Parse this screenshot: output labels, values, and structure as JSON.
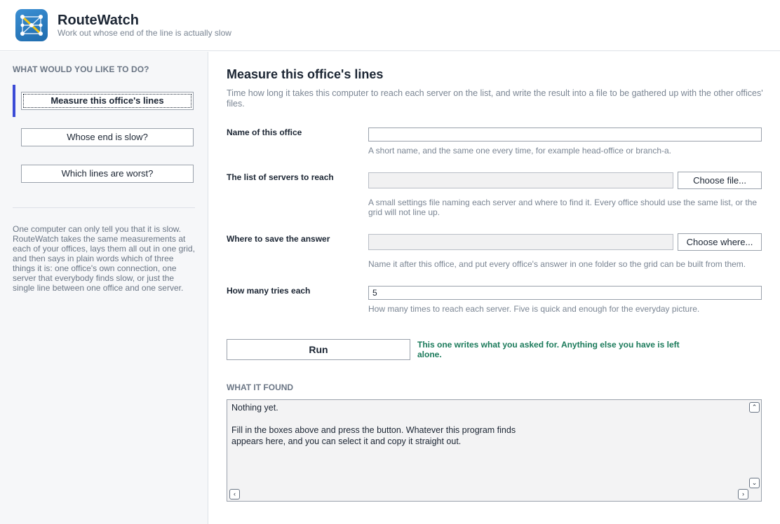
{
  "app": {
    "title": "RouteWatch",
    "subtitle": "Work out whose end of the line is actually slow"
  },
  "sidebar": {
    "heading": "WHAT WOULD YOU LIKE TO DO?",
    "items": [
      {
        "label": "Measure this office's lines",
        "active": true
      },
      {
        "label": "Whose end is slow?",
        "active": false
      },
      {
        "label": "Which lines are worst?",
        "active": false
      }
    ],
    "blurb": "One computer can only tell you that it is slow. RouteWatch takes the same measurements at each of your offices, lays them all out in one grid, and then says in plain words which of three things it is: one office's own connection, one server that everybody finds slow, or just the single line between one office and one server."
  },
  "main": {
    "title": "Measure this office's lines",
    "description": "Time how long it takes this computer to reach each server on the list, and write the result into a file to be gathered up with the other offices' files.",
    "fields": {
      "office_name": {
        "label": "Name of this office",
        "value": "",
        "hint": "A short name, and the same one every time, for example head-office or branch-a."
      },
      "server_list": {
        "label": "The list of servers to reach",
        "value": "",
        "button": "Choose file...",
        "hint": "A small settings file naming each server and where to find it. Every office should use the same list, or the grid will not line up."
      },
      "save_location": {
        "label": "Where to save the answer",
        "value": "",
        "button": "Choose where...",
        "hint": "Name it after this office, and put every office's answer in one folder so the grid can be built from them."
      },
      "tries": {
        "label": "How many tries each",
        "value": "5",
        "hint": "How many times to reach each server. Five is quick and enough for the everyday picture."
      }
    },
    "run_label": "Run",
    "run_note": "This one writes what you asked for. Anything else you have is left alone.",
    "found_heading": "WHAT IT FOUND",
    "output": "Nothing yet.\n\nFill in the boxes above and press the button. Whatever this program finds\nappears here, and you can select it and copy it straight out."
  },
  "icons": {
    "app": "network-graph-icon",
    "scroll_up": "chevron-up-icon",
    "scroll_down": "chevron-down-icon",
    "scroll_left": "chevron-left-icon",
    "scroll_right": "chevron-right-icon"
  },
  "colors": {
    "accent": "#3b4bd6",
    "note_green": "#1a7a5a",
    "icon_blue": "#2a7bc0",
    "icon_yellow": "#f0c419"
  }
}
